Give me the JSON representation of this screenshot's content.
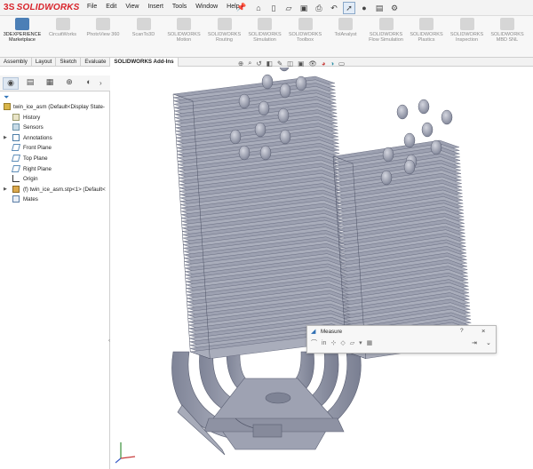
{
  "app": {
    "logo_text": "SOLIDWORKS",
    "logo_mark": "3S"
  },
  "menu": [
    "File",
    "Edit",
    "View",
    "Insert",
    "Tools",
    "Window",
    "Help"
  ],
  "command_manager": [
    {
      "label": "3DEXPERIENCE Marketplace",
      "active": true
    },
    {
      "label": "CircuitWorks",
      "active": false
    },
    {
      "label": "PhotoView 360",
      "active": false
    },
    {
      "label": "ScanTo3D",
      "active": false
    },
    {
      "label": "SOLIDWORKS Motion",
      "active": false
    },
    {
      "label": "SOLIDWORKS Routing",
      "active": false
    },
    {
      "label": "SOLIDWORKS Simulation",
      "active": false
    },
    {
      "label": "SOLIDWORKS Toolbox",
      "active": false
    },
    {
      "label": "TolAnalyst",
      "active": false
    },
    {
      "label": "SOLIDWORKS Flow Simulation",
      "active": false
    },
    {
      "label": "SOLIDWORKS Plastics",
      "active": false
    },
    {
      "label": "SOLIDWORKS Inspection",
      "active": false
    },
    {
      "label": "SOLIDWORKS MBD SNL",
      "active": false
    }
  ],
  "tabs": [
    {
      "label": "Assembly",
      "active": false
    },
    {
      "label": "Layout",
      "active": false
    },
    {
      "label": "Sketch",
      "active": false
    },
    {
      "label": "Evaluate",
      "active": false
    },
    {
      "label": "SOLIDWORKS Add-Ins",
      "active": true
    }
  ],
  "feature_tree": {
    "root": "twin_ice_asm  (Default<Display State-",
    "items": [
      {
        "label": "History",
        "icon": "history-icon",
        "expandable": false
      },
      {
        "label": "Sensors",
        "icon": "sensors-icon",
        "expandable": false
      },
      {
        "label": "Annotations",
        "icon": "annotations-icon",
        "expandable": true
      },
      {
        "label": "Front Plane",
        "icon": "plane-icon",
        "expandable": false
      },
      {
        "label": "Top Plane",
        "icon": "plane-icon",
        "expandable": false
      },
      {
        "label": "Right Plane",
        "icon": "plane-icon",
        "expandable": false
      },
      {
        "label": "Origin",
        "icon": "origin-icon",
        "expandable": false
      },
      {
        "label": "(f) twin_ice_asm.stp<1> (Default<",
        "icon": "part-icon",
        "expandable": true
      },
      {
        "label": "Mates",
        "icon": "mates-icon",
        "expandable": false
      }
    ]
  },
  "measure": {
    "title": "Measure",
    "help": "?",
    "close": "×"
  },
  "colors": {
    "accent": "#d8232a",
    "model_body": "#a8acba",
    "model_edge": "#5a5f72",
    "selection": "#dfe8f2"
  }
}
